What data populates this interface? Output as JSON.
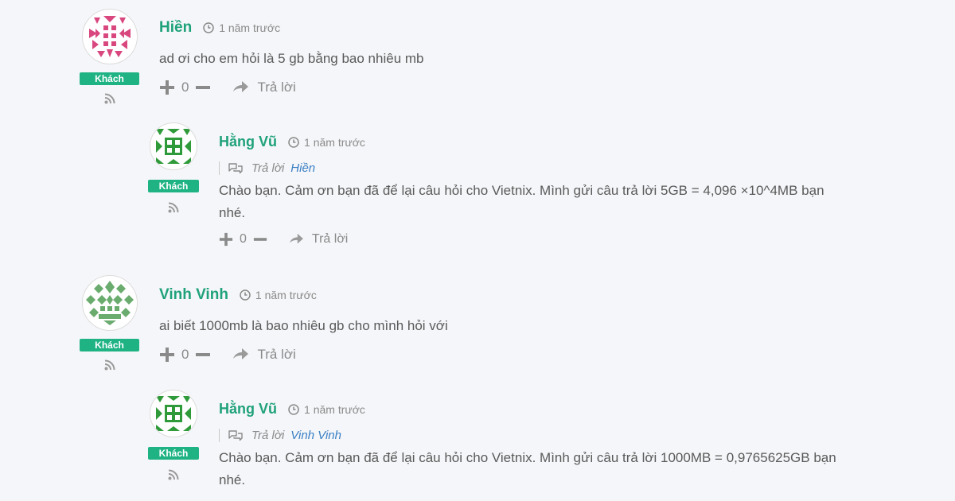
{
  "comments": [
    {
      "author": "Hiền",
      "time": "1 năm trước",
      "badge": "Khách",
      "text": "ad ơi cho em hỏi là 5 gb bằng bao nhiêu mb",
      "votes": "0",
      "reply_label": "Trả lời"
    },
    {
      "author": "Hằng Vũ",
      "time": "1 năm trước",
      "badge": "Khách",
      "reply_to_label": "Trả lời",
      "reply_to": "Hiền",
      "text": "Chào bạn. Cảm ơn bạn đã để lại câu hỏi cho Vietnix. Mình gửi câu trả lời 5GB = 4,096 ×10^4MB bạn nhé.",
      "votes": "0",
      "reply_label": "Trả lời"
    },
    {
      "author": "Vinh Vinh",
      "time": "1 năm trước",
      "badge": "Khách",
      "text": "ai biết 1000mb là bao nhiêu gb cho mình hỏi với",
      "votes": "0",
      "reply_label": "Trả lời"
    },
    {
      "author": "Hằng Vũ",
      "time": "1 năm trước",
      "badge": "Khách",
      "reply_to_label": "Trả lời",
      "reply_to": "Vinh Vinh",
      "text": "Chào bạn. Cảm ơn bạn đã để lại câu hỏi cho Vietnix. Mình gửi câu trả lời 1000MB = 0,9765625GB bạn nhé."
    }
  ],
  "colors": {
    "accent": "#1fb384",
    "author": "#1fa27a",
    "link": "#3a7fc4",
    "avatar_pink": "#d9477f",
    "avatar_green": "#2f9a3a",
    "avatar_sage": "#6aab6e"
  },
  "icons": {
    "time": "clock-icon",
    "feed": "rss-icon",
    "upvote": "plus-icon",
    "downvote": "minus-icon",
    "reply": "reply-arrow-icon",
    "reply_context": "chat-bubbles-icon"
  }
}
